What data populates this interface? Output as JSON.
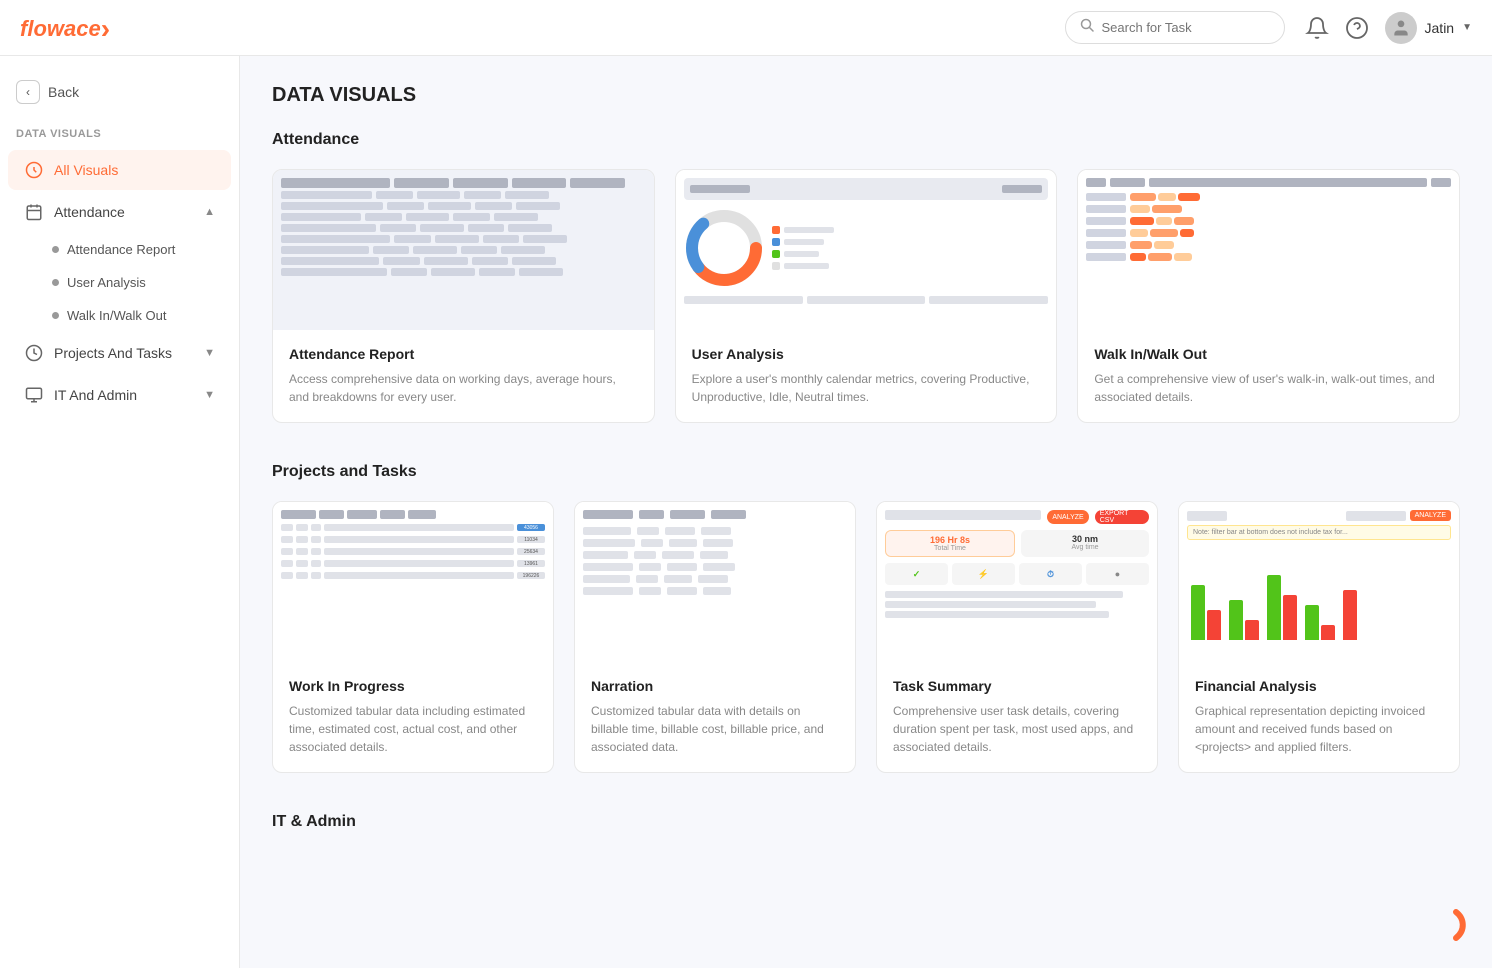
{
  "app": {
    "name_flow": "flow",
    "name_ace": "ace"
  },
  "topbar": {
    "search_placeholder": "Search for Task",
    "user_name": "Jatin"
  },
  "sidebar": {
    "back_label": "Back",
    "section_label": "DATA VISUALS",
    "all_visuals_label": "All Visuals",
    "attendance_label": "Attendance",
    "attendance_sub": [
      {
        "label": "Attendance Report"
      },
      {
        "label": "User Analysis"
      },
      {
        "label": "Walk In/Walk Out"
      }
    ],
    "projects_tasks_label": "Projects And Tasks",
    "it_admin_label": "IT And Admin"
  },
  "main": {
    "page_title": "DATA VISUALS",
    "sections": [
      {
        "title": "Attendance",
        "cards": [
          {
            "title": "Attendance Report",
            "desc": "Access comprehensive data on working days, average hours, and breakdowns for every user.",
            "preview_type": "table"
          },
          {
            "title": "User Analysis",
            "desc": "Explore a user's monthly calendar metrics, covering Productive, Unproductive, Idle, Neutral times.",
            "preview_type": "donut"
          },
          {
            "title": "Walk In/Walk Out",
            "desc": "Get a comprehensive view of user's walk-in, walk-out times, and associated details.",
            "preview_type": "walkin"
          }
        ]
      },
      {
        "title": "Projects and Tasks",
        "cards": [
          {
            "title": "Work In Progress",
            "desc": "Customized tabular data including estimated time, estimated cost, actual cost, and other associated details.",
            "preview_type": "wip"
          },
          {
            "title": "Narration",
            "desc": "Customized tabular data with details on billable time, billable cost, billable price, and associated data.",
            "preview_type": "narration"
          },
          {
            "title": "Task Summary",
            "desc": "Comprehensive user task details, covering duration spent per task, most used apps, and associated details.",
            "preview_type": "tasksummary"
          },
          {
            "title": "Financial Analysis",
            "desc": "Graphical representation depicting invoiced amount and received funds based on <projects> and applied filters.",
            "preview_type": "financial"
          }
        ]
      },
      {
        "title": "IT & Admin",
        "cards": []
      }
    ]
  }
}
